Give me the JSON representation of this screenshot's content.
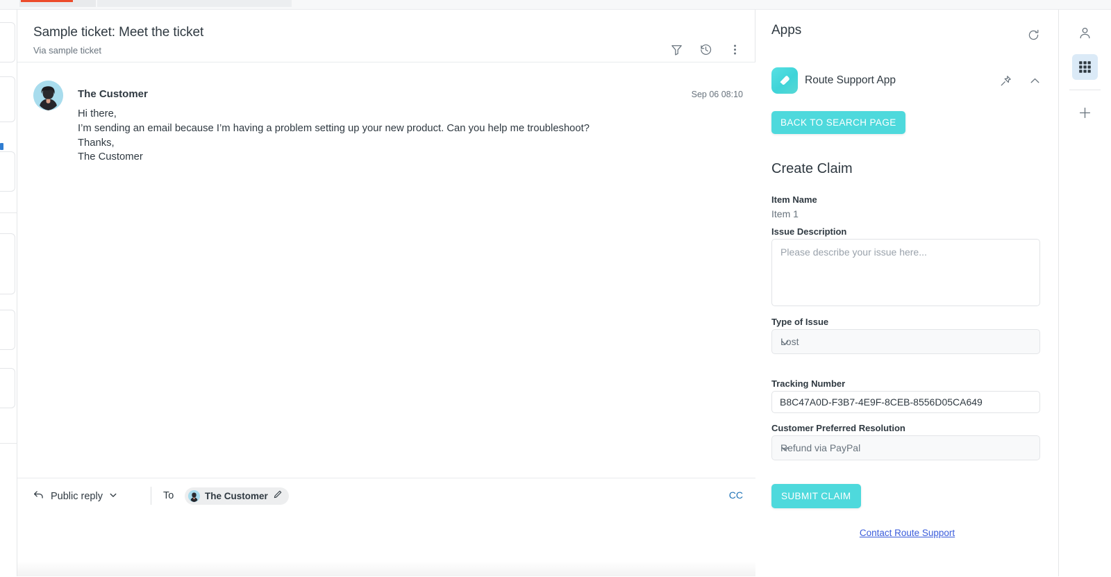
{
  "browser": {
    "tab_accent_color": "#ec4b2a"
  },
  "ticket": {
    "title": "Sample ticket: Meet the ticket",
    "subtitle": "Via sample ticket",
    "header_icons": [
      {
        "name": "filter-icon",
        "label": "Filter"
      },
      {
        "name": "history-icon",
        "label": "Events"
      },
      {
        "name": "more-icon",
        "label": "More options"
      }
    ],
    "message": {
      "author": "The Customer",
      "timestamp": "Sep 06 08:10",
      "body": "Hi there,\nI’m sending an email because I’m having a problem setting up your new product. Can you help me troubleshoot?\nThanks,\nThe Customer"
    }
  },
  "composer": {
    "reply_type": "Public reply",
    "to_label": "To",
    "recipient": "The Customer",
    "cc_label": "CC"
  },
  "apps_panel": {
    "title": "Apps",
    "refresh_label": "Refresh apps",
    "app": {
      "name": "Route Support App",
      "icon_color": "#4ed9dc",
      "pin_label": "Pin app",
      "collapse_label": "Collapse app"
    },
    "back_button": "BACK TO SEARCH PAGE",
    "form_title": "Create Claim",
    "fields": {
      "item_name_label": "Item Name",
      "item_name_value": "Item 1",
      "issue_description_label": "Issue Description",
      "issue_description_value": "",
      "issue_description_placeholder": "Please describe your issue here...",
      "type_of_issue_label": "Type of Issue",
      "type_of_issue_value": "Lost",
      "tracking_number_label": "Tracking Number",
      "tracking_number_value": "B8C47A0D-F3B7-4E9F-8CEB-8556D05CA649",
      "resolution_label": "Customer Preferred Resolution",
      "resolution_value": "Refund via PayPal"
    },
    "submit_button": "SUBMIT CLAIM",
    "contact_link": "Contact Route Support",
    "accent_color": "#4ed9dc",
    "link_color": "#3b5ddb"
  },
  "right_rail": {
    "items": [
      {
        "name": "user-icon",
        "label": "Customer context",
        "active": false
      },
      {
        "name": "apps-grid-icon",
        "label": "Apps",
        "active": true
      },
      {
        "name": "plus-icon",
        "label": "Add app",
        "active": false
      }
    ]
  }
}
